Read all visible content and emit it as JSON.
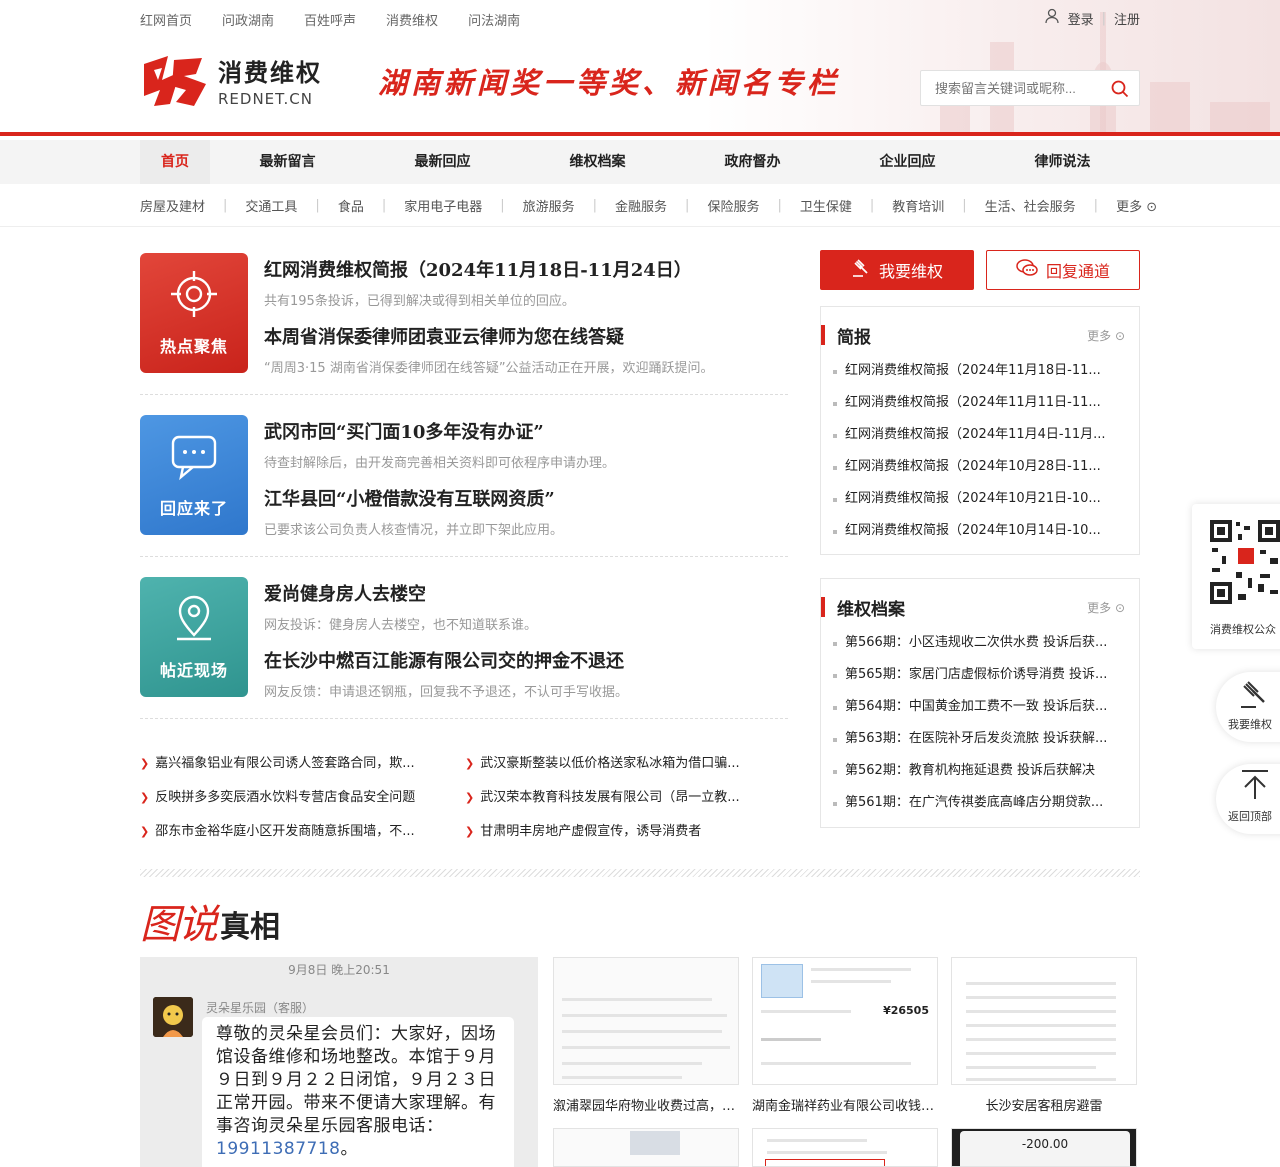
{
  "topnav": [
    "红网首页",
    "问政湖南",
    "百姓呼声",
    "消费维权",
    "问法湖南"
  ],
  "login": {
    "login_label": "登录",
    "separator": "|",
    "register_label": "注册"
  },
  "logo": {
    "title": "消费维权",
    "subtitle": "REDNET.CN"
  },
  "slogan": "湖南新闻奖一等奖、新闻名专栏",
  "search": {
    "placeholder": "搜索留言关键词或昵称..."
  },
  "mainnav": [
    "首页",
    "最新留言",
    "最新回应",
    "维权档案",
    "政府督办",
    "企业回应",
    "律师说法"
  ],
  "catnav": [
    "房屋及建材",
    "交通工具",
    "食品",
    "家用电子电器",
    "旅游服务",
    "金融服务",
    "保险服务",
    "卫生保健",
    "教育培训",
    "生活、社会服务",
    "更多"
  ],
  "blocks": [
    {
      "tile": "热点聚焦",
      "color": "#d9352c",
      "items": [
        {
          "title": "红网消费维权简报（2024年11月18日-11月24日）",
          "desc": "共有195条投诉，已得到解决或得到相关单位的回应。"
        },
        {
          "title": "本周省消保委律师团袁亚云律师为您在线答疑",
          "desc": "“周周3·15 湖南省消保委律师团在线答疑”公益活动正在开展，欢迎踊跃提问。"
        }
      ]
    },
    {
      "tile": "回应来了",
      "color": "#3d86d6",
      "items": [
        {
          "title": "武冈市回“买门面10多年没有办证”",
          "desc": "待查封解除后，由开发商完善相关资料即可依程序申请办理。"
        },
        {
          "title": "江华县回“小橙借款没有互联网资质”",
          "desc": "已要求该公司负责人核查情况，并立即下架此应用。"
        }
      ]
    },
    {
      "tile": "帖近现场",
      "color": "#3aa3a0",
      "items": [
        {
          "title": "爱尚健身房人去楼空",
          "desc": "网友投诉：健身房人去楼空，也不知道联系谁。"
        },
        {
          "title": "在长沙中燃百江能源有限公司交的押金不退还",
          "desc": "网友反馈：申请退还钢瓶，回复我不予退还，不认可手写收据。"
        }
      ]
    }
  ],
  "links": [
    "嘉兴福象铝业有限公司诱人签套路合同，欺...",
    "武汉豪斯整装以低价格送家私冰箱为借口骗...",
    "反映拼多多奕辰酒水饮料专营店食品安全问题",
    "武汉荣本教育科技发展有限公司（昂一立教...",
    "邵东市金裕华庭小区开发商随意拆围墙，不...",
    "甘肃明丰房地产虚假宣传，诱导消费者"
  ],
  "sidebar": {
    "btn_complain": "我要维权",
    "btn_reply": "回复通道",
    "more": "更多",
    "brief": {
      "title": "简报",
      "items": [
        "红网消费维权简报（2024年11月18日-11...",
        "红网消费维权简报（2024年11月11日-11...",
        "红网消费维权简报（2024年11月4日-11月...",
        "红网消费维权简报（2024年10月28日-11...",
        "红网消费维权简报（2024年10月21日-10...",
        "红网消费维权简报（2024年10月14日-10..."
      ]
    },
    "archive": {
      "title": "维权档案",
      "items": [
        "第566期：小区违规收二次供水费 投诉后获...",
        "第565期：家居门店虚假标价诱导消费 投诉...",
        "第564期：中国黄金加工费不一致 投诉后获...",
        "第563期：在医院补牙后发炎流脓 投诉获解...",
        "第562期：教育机构拖延退费 投诉后获解决",
        "第561期：在广汽传祺娄底高峰店分期贷款..."
      ]
    }
  },
  "float": {
    "qr_caption": "消费维权公众",
    "complain": "我要维权",
    "top": "返回顶部"
  },
  "section2": {
    "title_art": "图说",
    "title": "真相",
    "chat": {
      "time": "9月8日 晚上20:51",
      "name": "灵朵星乐园（客服）",
      "message": "尊敬的灵朵星会员们：大家好，因场馆设备维修和场地整改。本馆于９月９日到９月２２日闭馆，９月２３日正常开园。带来不便请大家理解。有事咨询灵朵星乐园客服电话：",
      "phone": "19911387718",
      "tail": "。"
    },
    "thumbs": [
      {
        "caption": "溆浦翠园华府物业收费过高，1.7..."
      },
      {
        "caption": "湖南金瑞祥药业有限公司收钱不..."
      },
      {
        "caption": "长沙安居客租房避雷"
      }
    ],
    "thumb2_price": "26505",
    "thumb4_amount": "-200.00"
  }
}
